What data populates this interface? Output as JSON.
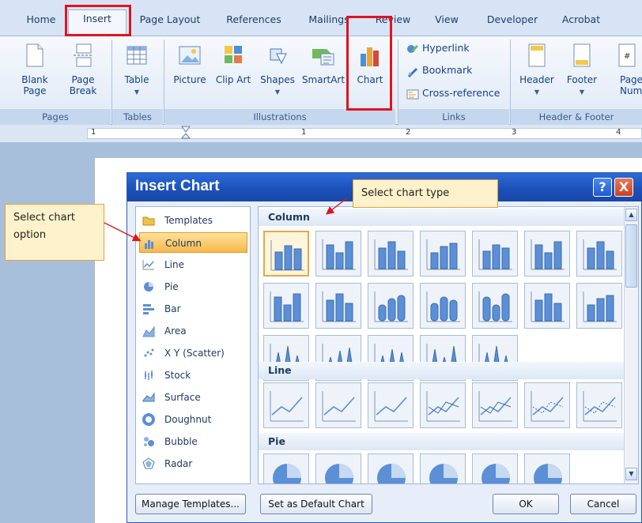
{
  "ribbon_tabs": [
    "Home",
    "Insert",
    "Page Layout",
    "References",
    "Mailings",
    "Review",
    "View",
    "Developer",
    "Acrobat"
  ],
  "ribbon": {
    "pages": {
      "blank_page": "Blank Page",
      "page_break": "Page Break",
      "label": "Pages"
    },
    "tables": {
      "table": "Table",
      "label": "Tables"
    },
    "illustrations": {
      "picture": "Picture",
      "clip_art": "Clip Art",
      "shapes": "Shapes",
      "smartart": "SmartArt",
      "chart": "Chart",
      "label": "Illustrations"
    },
    "links": {
      "hyperlink": "Hyperlink",
      "bookmark": "Bookmark",
      "cross_reference": "Cross-reference",
      "label": "Links"
    },
    "header_footer": {
      "header": "Header",
      "footer": "Footer",
      "page_number": "Page Numbe",
      "label": "Header & Footer"
    }
  },
  "ruler": {
    "numbers": [
      "1",
      "1",
      "2",
      "3",
      "4"
    ]
  },
  "callouts": {
    "left": "Select chart option",
    "top": "Select chart type"
  },
  "dialog": {
    "title": "Insert Chart",
    "help_label": "?",
    "close_label": "X",
    "categories": [
      "Templates",
      "Column",
      "Line",
      "Pie",
      "Bar",
      "Area",
      "X Y (Scatter)",
      "Stock",
      "Surface",
      "Doughnut",
      "Bubble",
      "Radar"
    ],
    "selected_category": "Column",
    "sections": [
      "Column",
      "Line",
      "Pie"
    ],
    "buttons": {
      "manage_templates": "Manage Templates...",
      "set_default": "Set as Default Chart",
      "ok": "OK",
      "cancel": "Cancel"
    }
  },
  "colors": {
    "highlight": "#e0141e",
    "title_bar": "#1b4fb8",
    "selection": "#f7b84c",
    "thumb_fill": "#5b8fd6"
  }
}
